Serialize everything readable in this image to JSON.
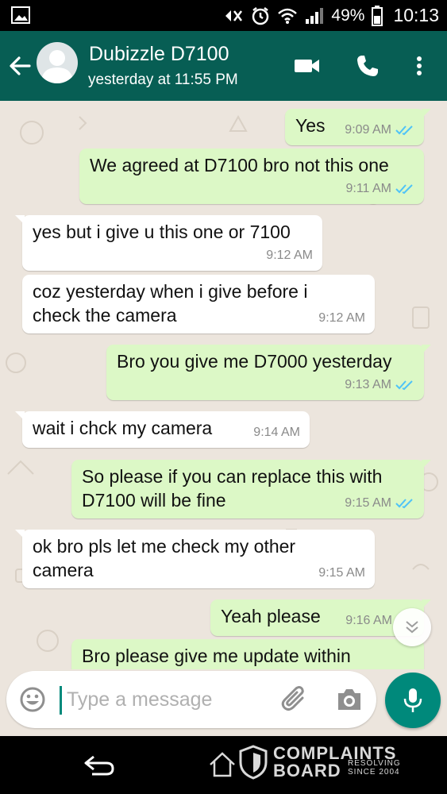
{
  "status_bar": {
    "battery": "49%",
    "time": "10:13",
    "icons": [
      "image-icon",
      "mute-icon",
      "alarm-icon",
      "wifi-icon",
      "signal-icon",
      "battery-icon"
    ]
  },
  "header": {
    "contact_name": "Dubizzle D7100",
    "last_seen": "yesterday at 11:55 PM",
    "icons": [
      "back-arrow-icon",
      "avatar",
      "video-call-icon",
      "phone-icon",
      "more-vert-icon"
    ]
  },
  "colors": {
    "header": "#075e54",
    "chat_bg": "#ece5dd",
    "outgoing": "#dcf8c6",
    "incoming": "#ffffff",
    "accent": "#00897b",
    "read_ticks": "#4fc3f7"
  },
  "messages": [
    {
      "dir": "out",
      "lines": [
        "Yes"
      ],
      "time": "9:09 AM",
      "ticks": "read"
    },
    {
      "dir": "out",
      "lines": [
        "We agreed at D7100 bro not this one"
      ],
      "time": "9:11 AM",
      "ticks": "read"
    },
    {
      "dir": "in",
      "lines": [
        "yes but i give u this one or 7100"
      ],
      "time": "9:12 AM"
    },
    {
      "dir": "in",
      "lines": [
        "coz yesterday when i give before i",
        "check the camera"
      ],
      "time": "9:12 AM"
    },
    {
      "dir": "out",
      "lines": [
        "Bro you give me D7000 yesterday"
      ],
      "time": "9:13 AM",
      "ticks": "read"
    },
    {
      "dir": "in",
      "lines": [
        "wait i chck my camera"
      ],
      "time": "9:14 AM"
    },
    {
      "dir": "out",
      "lines": [
        "So please if you can replace this with",
        "D7100 will be fine"
      ],
      "time": "9:15 AM",
      "ticks": "read"
    },
    {
      "dir": "in",
      "lines": [
        "ok bro pls let me check my other",
        "camera"
      ],
      "time": "9:15 AM"
    },
    {
      "dir": "out",
      "lines": [
        "Yeah please"
      ],
      "time": "9:16 AM",
      "ticks": "read"
    },
    {
      "dir": "out",
      "lines": [
        "Bro please give me update within"
      ],
      "time": "",
      "ticks": "",
      "partial": true
    }
  ],
  "composer": {
    "placeholder": "Type a message",
    "icons": [
      "emoji-icon",
      "attach-icon",
      "camera-icon",
      "mic-icon"
    ]
  },
  "navigation": {
    "icons": [
      "nav-back-icon"
    ]
  },
  "watermark": {
    "line1": "COMPLAINTS",
    "line2": "BOARD",
    "tagline": "RESOLVING SINCE 2004"
  }
}
